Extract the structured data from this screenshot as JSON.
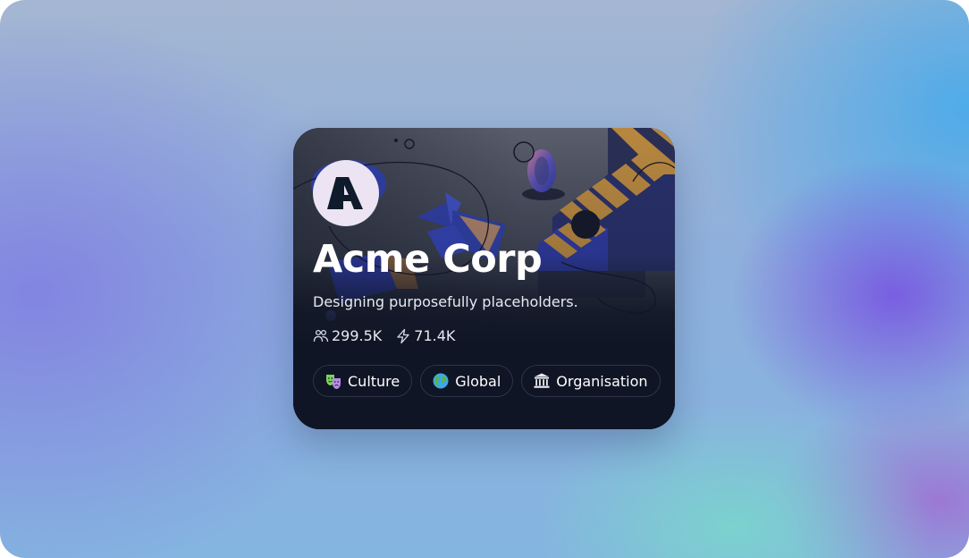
{
  "profile": {
    "name": "Acme Corp",
    "tagline": "Designing purposefully placeholders.",
    "avatar_letter": "A",
    "followers_icon": "users-icon",
    "followers": "299.5K",
    "activity_icon": "lightning-bolt-icon",
    "activity": "71.4K"
  },
  "tags": [
    {
      "label": "Culture",
      "icon": "theater-masks-icon"
    },
    {
      "label": "Global",
      "icon": "globe-icon"
    },
    {
      "label": "Organisation",
      "icon": "classical-building-icon"
    }
  ],
  "colors": {
    "card_background": "#0f1524",
    "avatar_background": "#ece4f2",
    "accent_blue": "#2f3fa3",
    "accent_orange": "#b8873f",
    "text": "#ffffff"
  }
}
